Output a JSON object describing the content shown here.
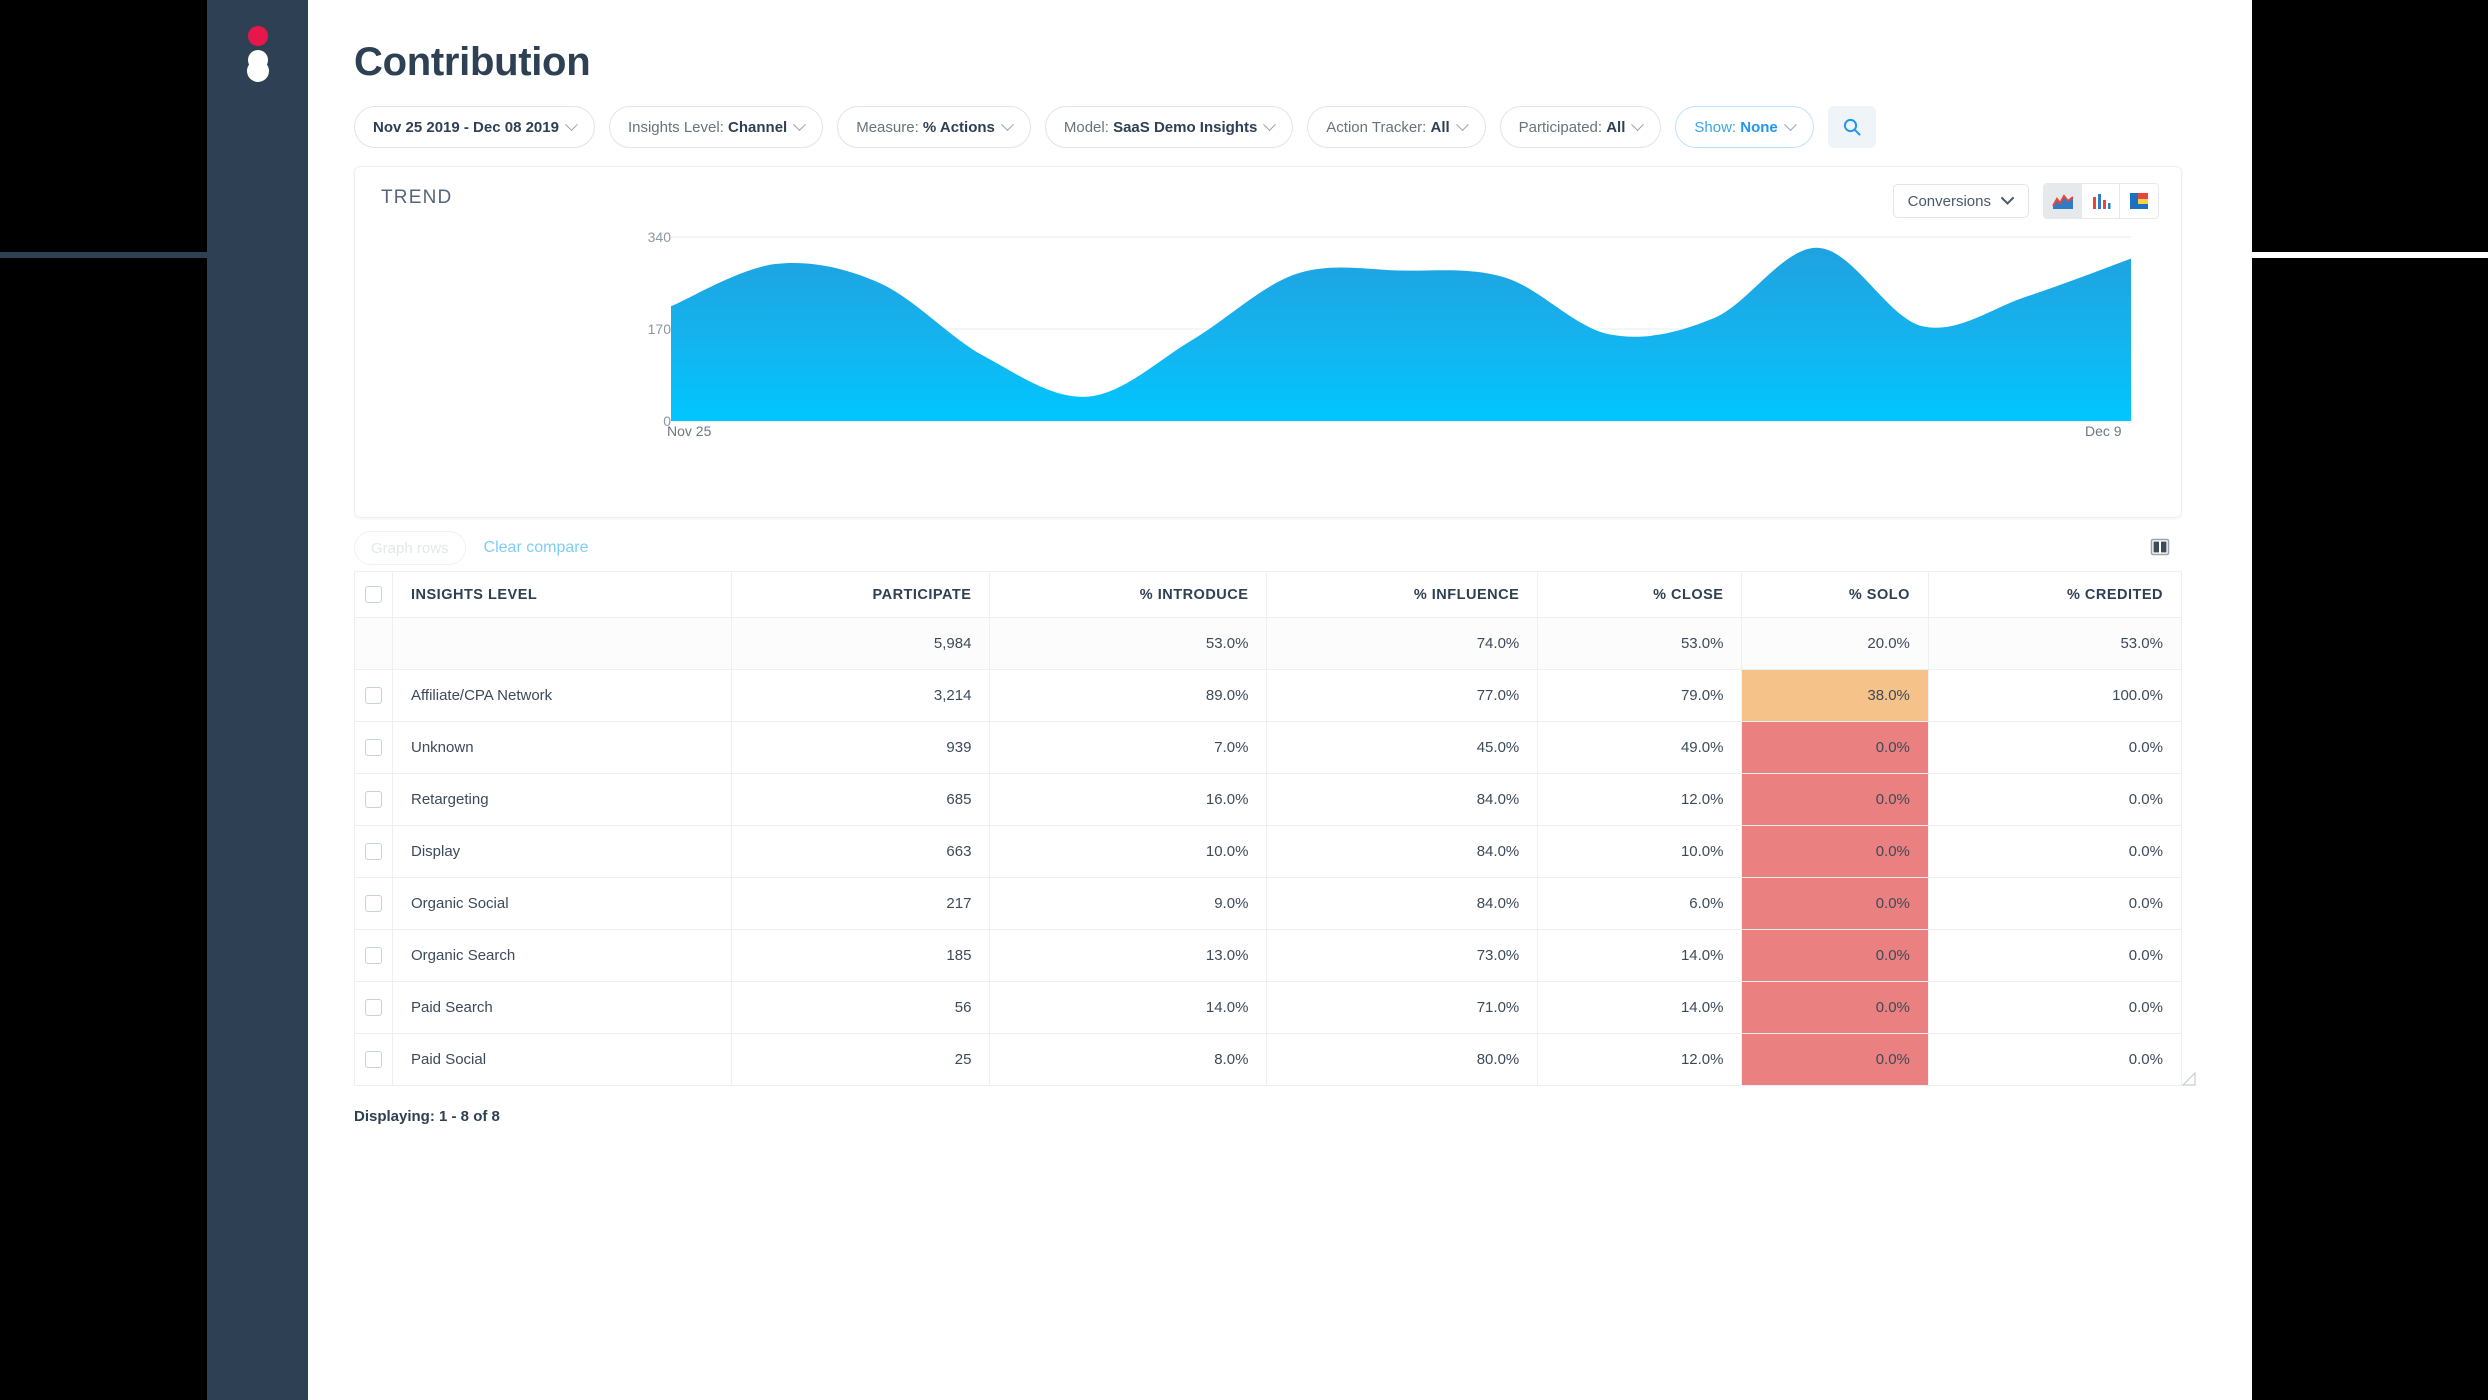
{
  "sidebar": {
    "logo_name": "app-logo",
    "logo_colors": {
      "dot_red": "#e8174a",
      "dot_white": "#ffffff",
      "background": "#2e4053"
    }
  },
  "header": {
    "title": "Contribution"
  },
  "filters": [
    {
      "name": "date-range-filter",
      "lead": "",
      "value": "Nov 25 2019 - Dec 08 2019",
      "accent": false
    },
    {
      "name": "insights-level-filter",
      "lead": "Insights Level: ",
      "value": "Channel",
      "accent": false
    },
    {
      "name": "measure-filter",
      "lead": "Measure: ",
      "value": "% Actions",
      "accent": false
    },
    {
      "name": "model-filter",
      "lead": "Model: ",
      "value": "SaaS Demo Insights",
      "accent": false
    },
    {
      "name": "action-tracker-filter",
      "lead": "Action Tracker: ",
      "value": "All",
      "accent": false
    },
    {
      "name": "participated-filter",
      "lead": "Participated: ",
      "value": "All",
      "accent": false
    },
    {
      "name": "show-filter",
      "lead": "Show: ",
      "value": "None",
      "accent": true
    }
  ],
  "search": {
    "icon": "search-icon"
  },
  "trend_card": {
    "label": "TREND",
    "metric_select": {
      "label": "Conversions",
      "icon": "chevron-down-icon"
    },
    "chart_types": [
      {
        "name": "area-chart-toggle",
        "icon": "area-chart-icon",
        "active": true
      },
      {
        "name": "bar-chart-toggle",
        "icon": "bar-chart-icon",
        "active": false
      },
      {
        "name": "stacked-chart-toggle",
        "icon": "stacked-chart-icon",
        "active": false
      }
    ]
  },
  "chart_data": {
    "type": "area",
    "title": "TREND",
    "xlabel": "",
    "ylabel": "",
    "ylim": [
      0,
      340
    ],
    "yticks": [
      0,
      170,
      340
    ],
    "ytick_labels": [
      "0",
      "170",
      "340"
    ],
    "xtick_labels": [
      "Nov 25",
      "Dec 9"
    ],
    "grid": true,
    "legend": "none",
    "series_name": "Conversions",
    "x": [
      "Nov 25",
      "Nov 26",
      "Nov 27",
      "Nov 28",
      "Nov 29",
      "Nov 30",
      "Dec 1",
      "Dec 2",
      "Dec 3",
      "Dec 4",
      "Dec 5",
      "Dec 6",
      "Dec 7",
      "Dec 8",
      "Dec 9"
    ],
    "values": [
      212,
      290,
      255,
      120,
      45,
      150,
      272,
      278,
      265,
      160,
      190,
      320,
      175,
      230,
      300
    ]
  },
  "compare_row": {
    "graph_rows_label": "Graph rows",
    "clear_compare_label": "Clear compare",
    "columns_icon": "columns-layout-icon"
  },
  "table": {
    "columns": [
      "INSIGHTS LEVEL",
      "PARTICIPATE",
      "% INTRODUCE",
      "% INFLUENCE",
      "% CLOSE",
      "% SOLO",
      "% CREDITED"
    ],
    "summary": {
      "participate": "5,984",
      "introduce": "53.0%",
      "influence": "74.0%",
      "close": "53.0%",
      "solo": "20.0%",
      "credited": "53.0%"
    },
    "rows": [
      {
        "name": "Affiliate/CPA Network",
        "participate": "3,214",
        "introduce": "89.0%",
        "influence": "77.0%",
        "close": "79.0%",
        "solo": "38.0%",
        "solo_state": "orange",
        "credited": "100.0%"
      },
      {
        "name": "Unknown",
        "participate": "939",
        "introduce": "7.0%",
        "influence": "45.0%",
        "close": "49.0%",
        "solo": "0.0%",
        "solo_state": "red",
        "credited": "0.0%"
      },
      {
        "name": "Retargeting",
        "participate": "685",
        "introduce": "16.0%",
        "influence": "84.0%",
        "close": "12.0%",
        "solo": "0.0%",
        "solo_state": "red",
        "credited": "0.0%"
      },
      {
        "name": "Display",
        "participate": "663",
        "introduce": "10.0%",
        "influence": "84.0%",
        "close": "10.0%",
        "solo": "0.0%",
        "solo_state": "red",
        "credited": "0.0%"
      },
      {
        "name": "Organic Social",
        "participate": "217",
        "introduce": "9.0%",
        "influence": "84.0%",
        "close": "6.0%",
        "solo": "0.0%",
        "solo_state": "red",
        "credited": "0.0%"
      },
      {
        "name": "Organic Search",
        "participate": "185",
        "introduce": "13.0%",
        "influence": "73.0%",
        "close": "14.0%",
        "solo": "0.0%",
        "solo_state": "red",
        "credited": "0.0%"
      },
      {
        "name": "Paid Search",
        "participate": "56",
        "introduce": "14.0%",
        "influence": "71.0%",
        "close": "14.0%",
        "solo": "0.0%",
        "solo_state": "red",
        "credited": "0.0%"
      },
      {
        "name": "Paid Social",
        "participate": "25",
        "introduce": "8.0%",
        "influence": "80.0%",
        "close": "12.0%",
        "solo": "0.0%",
        "solo_state": "red",
        "credited": "0.0%"
      }
    ]
  },
  "footer": {
    "displaying": "Displaying: 1 - 8 of 8"
  },
  "colors": {
    "sidebar": "#2e4053",
    "accent_blue": "#2196f3",
    "chart_top": "#1fa2e0",
    "chart_bottom": "#00c6ff",
    "cell_orange": "#f5c28a",
    "cell_red": "#ea8080"
  }
}
